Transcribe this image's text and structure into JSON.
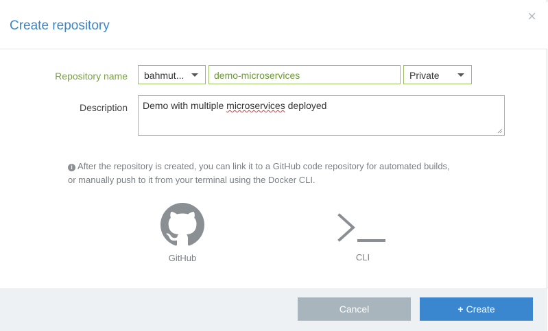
{
  "dialog": {
    "title": "Create repository",
    "close_glyph": "×"
  },
  "form": {
    "name_label": "Repository name",
    "namespace_value": "bahmut...",
    "repo_name_value": "demo-microservices",
    "visibility_value": "Private",
    "description_label": "Description",
    "description_prefix": "Demo with multiple ",
    "description_misspelled": "microservices",
    "description_suffix": " deployed"
  },
  "info": {
    "line1": "After the repository is created, you can link it to a GitHub code repository for automated builds,",
    "line2": "or manually push to it from your terminal using the Docker CLI."
  },
  "options": {
    "github_label": "GitHub",
    "cli_label": "CLI"
  },
  "footer": {
    "cancel_label": "Cancel",
    "create_plus": "+",
    "create_label": "Create"
  },
  "colors": {
    "title_blue": "#3b86c8",
    "valid_green": "#9bbe63",
    "focus_orange": "#e3a54d",
    "create_blue": "#3b87cf",
    "cancel_gray": "#a9b5bc"
  }
}
